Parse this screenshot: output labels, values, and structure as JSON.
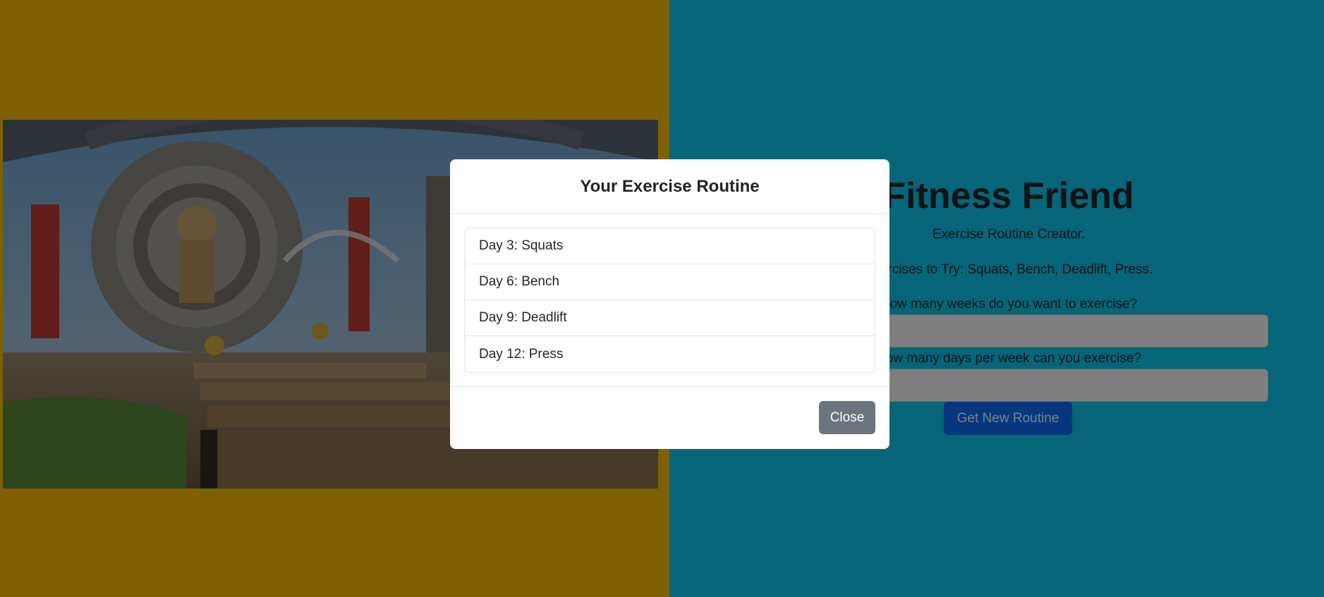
{
  "page": {
    "left_bg_color": "#FFC107",
    "right_bg_color": "#0DCAF0"
  },
  "hero": {
    "icon": "game-scene-image"
  },
  "app": {
    "title": "Fitness Friend",
    "subtitle": "Exercise Routine Creator.",
    "exercises_text": "Exercises to Try: Squats, Bench, Deadlift, Press.",
    "weeks_label": "How many weeks do you want to exercise?",
    "weeks_value": "",
    "days_label": "How many days per week can you exercise?",
    "days_value": "",
    "routine_button_label": "Get New Routine",
    "accent_color": "#0D6EFD"
  },
  "modal": {
    "title": "Your Exercise Routine",
    "routine": [
      "Day 3: Squats",
      "Day 6: Bench",
      "Day 9: Deadlift",
      "Day 12: Press"
    ],
    "close_label": "Close",
    "close_color": "#6C757D"
  }
}
